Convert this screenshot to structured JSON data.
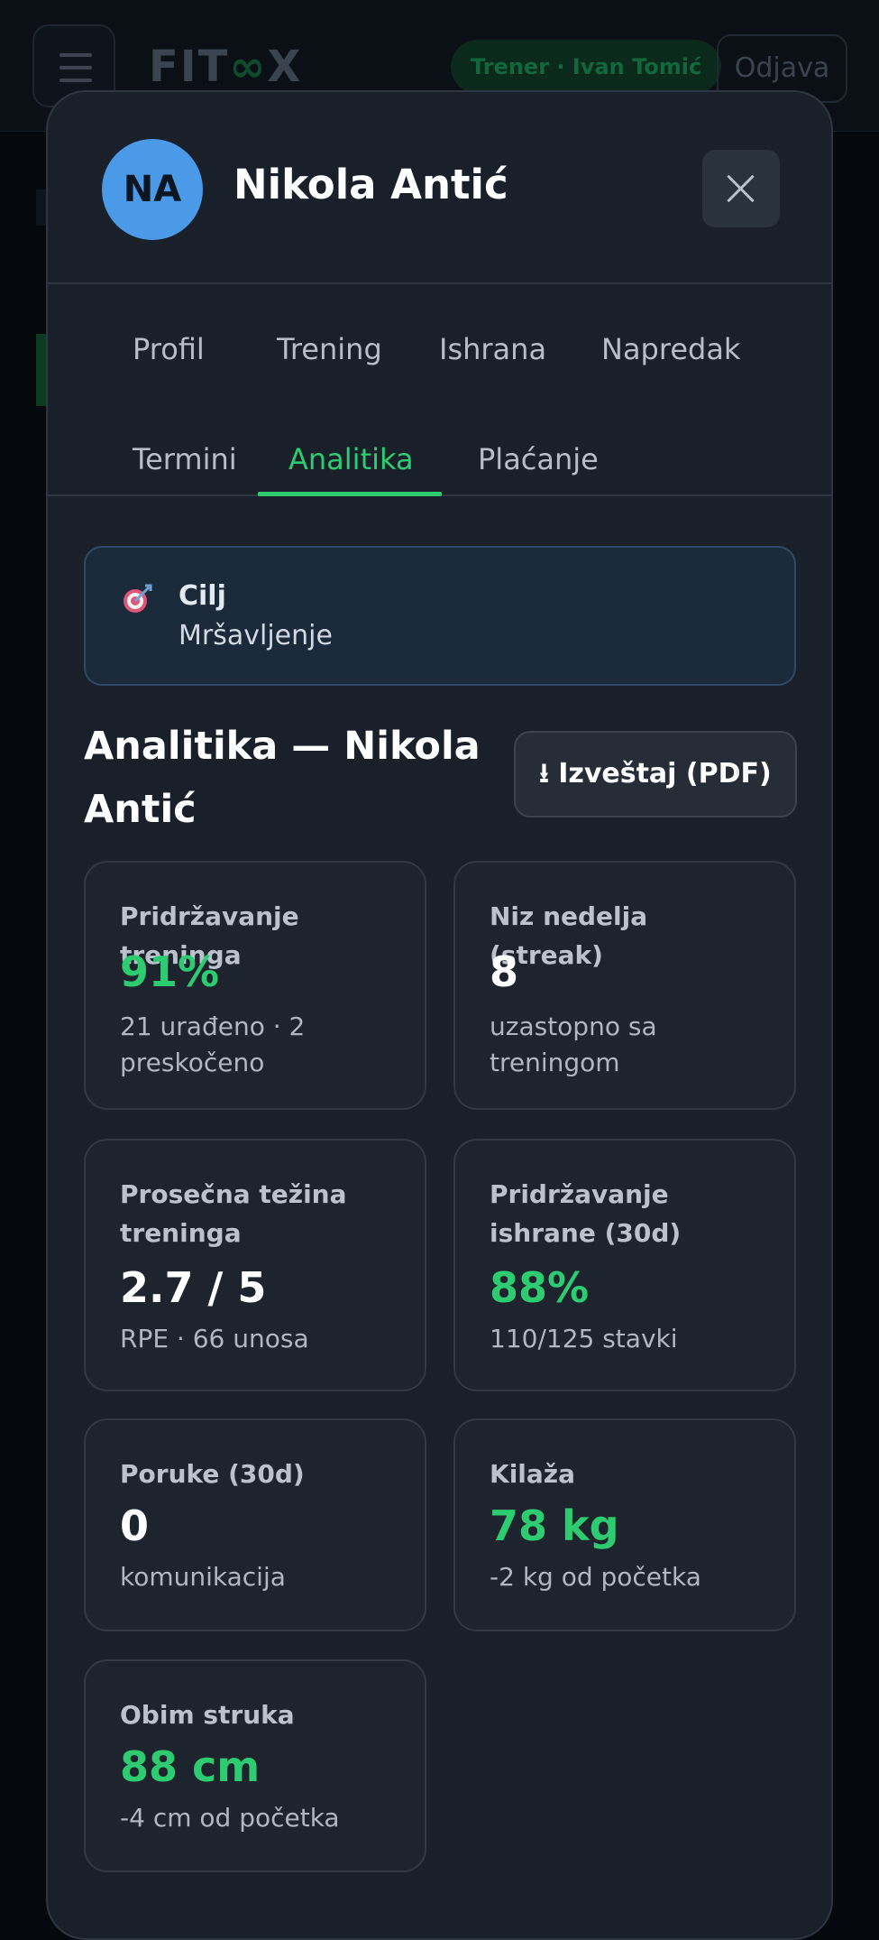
{
  "app": {
    "logo_left": "FIT",
    "logo_mid": "∞",
    "logo_right": "X",
    "trainer_badge": "Trener · Ivan Tomić",
    "logout_label": "Odjava"
  },
  "modal": {
    "avatar_initials": "NA",
    "client_name": "Nikola Antić",
    "close_icon": "close-icon",
    "tabs": [
      {
        "label": "Profil",
        "active": false
      },
      {
        "label": "Trening",
        "active": false
      },
      {
        "label": "Ishrana",
        "active": false
      },
      {
        "label": "Napredak",
        "active": false
      },
      {
        "label": "Termini",
        "active": false
      },
      {
        "label": "Analitika",
        "active": true
      },
      {
        "label": "Plaćanje",
        "active": false
      }
    ],
    "goal": {
      "icon": "target-icon",
      "title": "Cilj",
      "value": "Mršavljenje"
    },
    "section_title": "Analitika — Nikola Antić",
    "report_button": "⭳ Izveštaj (PDF)",
    "cards": [
      {
        "label": "Pridržavanje treninga",
        "value": "91%",
        "sub": "21 urađeno · 2 preskočeno"
      },
      {
        "label": "Niz nedelja (streak)",
        "value": "8",
        "sub": "uzastopno sa treningom"
      },
      {
        "label": "Prosečna težina treninga",
        "value": "2.7 / 5",
        "sub": "RPE · 66 unosa"
      },
      {
        "label": "Pridržavanje ishrane (30d)",
        "value": "88%",
        "sub": "110/125 stavki"
      },
      {
        "label": "Poruke (30d)",
        "value": "0",
        "sub": "komunikacija"
      },
      {
        "label": "Kilaža",
        "value": "78 kg",
        "sub": "-2 kg od početka"
      },
      {
        "label": "Obim struka",
        "value": "88 cm",
        "sub": "-4 cm od početka"
      }
    ]
  },
  "colors": {
    "accent_green": "#2ecc71",
    "avatar_blue": "#4a9ae8",
    "modal_bg": "#1a2029"
  }
}
